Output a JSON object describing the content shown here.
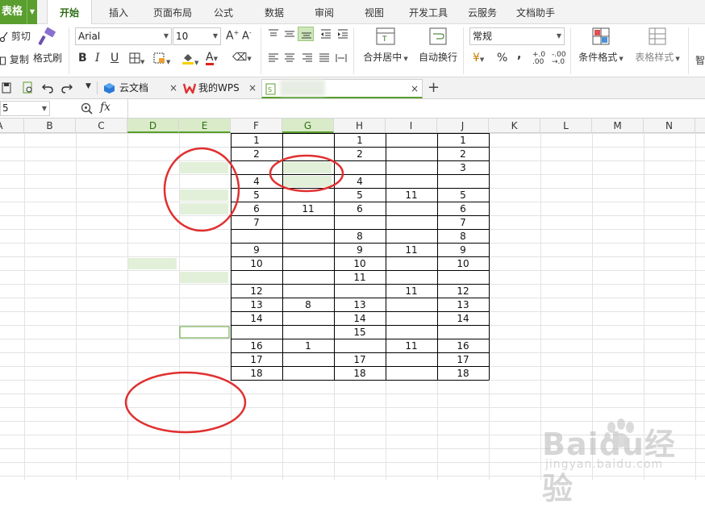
{
  "app": {
    "name": "表格"
  },
  "ribbon_tabs": [
    "开始",
    "插入",
    "页面布局",
    "公式",
    "数据",
    "审阅",
    "视图",
    "开发工具",
    "云服务",
    "文档助手"
  ],
  "clipboard": {
    "cut": "剪切",
    "copy": "复制",
    "format_painter": "格式刷"
  },
  "font": {
    "name": "Arial",
    "size": "10"
  },
  "alignment": {
    "merge_center": "合并居中",
    "wrap_text": "自动换行"
  },
  "number": {
    "format": "常规",
    "percent": "%",
    "thousands": ","
  },
  "styles": {
    "conditional_format": "条件格式",
    "table_style": "表格样式",
    "smart_fill": "智"
  },
  "doc_tabs": [
    {
      "label": "云文档"
    },
    {
      "label": "我的WPS"
    },
    {
      "label": ""
    }
  ],
  "add_tab": "+",
  "formula_bar": {
    "name_box": "5",
    "fx": "fx",
    "formula": ""
  },
  "columns": [
    "A",
    "B",
    "C",
    "D",
    "E",
    "F",
    "G",
    "H",
    "I",
    "J",
    "K",
    "L",
    "M",
    "N"
  ],
  "table": {
    "rows": [
      {
        "f": "1",
        "g": "",
        "h": "1",
        "i": "",
        "j": "1"
      },
      {
        "f": "2",
        "g": "",
        "h": "2",
        "i": "",
        "j": "2"
      },
      {
        "f": "",
        "g": "",
        "h": "",
        "i": "",
        "j": "3"
      },
      {
        "f": "4",
        "g": "",
        "h": "4",
        "i": "",
        "j": ""
      },
      {
        "f": "5",
        "g": "",
        "h": "5",
        "i": "11",
        "j": "5"
      },
      {
        "f": "6",
        "g": "11",
        "h": "6",
        "i": "",
        "j": "6"
      },
      {
        "f": "7",
        "g": "",
        "h": "",
        "i": "",
        "j": "7"
      },
      {
        "f": "",
        "g": "",
        "h": "8",
        "i": "",
        "j": "8"
      },
      {
        "f": "9",
        "g": "",
        "h": "9",
        "i": "11",
        "j": "9"
      },
      {
        "f": "10",
        "g": "",
        "h": "10",
        "i": "",
        "j": "10"
      },
      {
        "f": "",
        "g": "",
        "h": "11",
        "i": "",
        "j": ""
      },
      {
        "f": "12",
        "g": "",
        "h": "",
        "i": "11",
        "j": "12"
      },
      {
        "f": "13",
        "g": "8",
        "h": "13",
        "i": "",
        "j": "13"
      },
      {
        "f": "14",
        "g": "",
        "h": "14",
        "i": "",
        "j": "14"
      },
      {
        "f": "",
        "g": "",
        "h": "15",
        "i": "",
        "j": ""
      },
      {
        "f": "16",
        "g": "1",
        "h": "",
        "i": "11",
        "j": "16"
      },
      {
        "f": "17",
        "g": "",
        "h": "17",
        "i": "",
        "j": "17"
      },
      {
        "f": "18",
        "g": "",
        "h": "18",
        "i": "",
        "j": "18"
      }
    ]
  },
  "watermark": {
    "brand": "Baidu经验",
    "url": "jingyan.baidu.com"
  },
  "colors": {
    "accent_green": "#5a9e2f",
    "highlight_cell": "#e2f0d9",
    "annotation_red": "#e03030"
  },
  "icons": [
    "cut-icon",
    "copy-icon",
    "format-painter-icon",
    "bold-icon",
    "italic-icon",
    "underline-icon",
    "border-icon",
    "fill-color-icon",
    "font-color-icon",
    "undo-icon",
    "redo-icon",
    "cloud-doc-icon",
    "wps-logo-icon",
    "sheet-file-icon",
    "zoom-icon",
    "fx-icon"
  ]
}
